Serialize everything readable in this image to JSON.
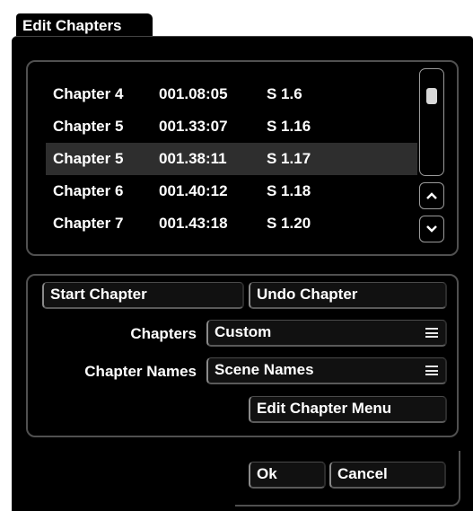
{
  "tab": {
    "title": "Edit Chapters"
  },
  "chapters": [
    {
      "name": "Chapter 4",
      "time": "001.08:05",
      "scene": "S 1.6",
      "selected": false
    },
    {
      "name": "Chapter 5",
      "time": "001.33:07",
      "scene": "S 1.16",
      "selected": false
    },
    {
      "name": "Chapter 5",
      "time": "001.38:11",
      "scene": "S 1.17",
      "selected": true
    },
    {
      "name": "Chapter 6",
      "time": "001.40:12",
      "scene": "S 1.18",
      "selected": false
    },
    {
      "name": "Chapter 7",
      "time": "001.43:18",
      "scene": "S 1.20",
      "selected": false
    }
  ],
  "buttons": {
    "start_chapter": "Start Chapter",
    "undo_chapter": "Undo Chapter",
    "edit_menu": "Edit Chapter Menu",
    "ok": "Ok",
    "cancel": "Cancel"
  },
  "fields": {
    "chapters_label": "Chapters",
    "chapters_value": "Custom",
    "names_label": "Chapter Names",
    "names_value": "Scene Names"
  },
  "icons": {
    "scroll_up": "chevron-up-icon",
    "scroll_down": "chevron-down-icon",
    "dropdown": "menu-icon"
  }
}
